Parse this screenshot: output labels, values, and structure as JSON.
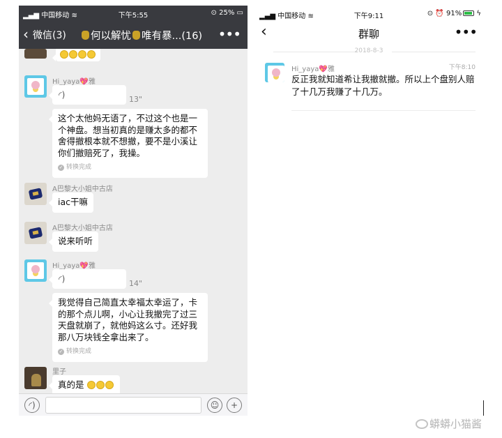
{
  "left_phone": {
    "status": {
      "carrier": "中国移动",
      "time": "下午5:55",
      "battery": "25%"
    },
    "nav": {
      "back_label": "微信(3)",
      "title_part1": "何以解忧",
      "title_part2": "唯有暴...(16)"
    },
    "messages": [
      {
        "sender": "Hi_yaya💖雅",
        "voice_duration": "13\""
      },
      {
        "text": "这个太他妈无语了，不过这个也是一个神盘。想当初真的是赚太多的都不舍得撤根本就不想撤，要不是小溪让你们撤赔死了，我操。",
        "status": "转换完成"
      },
      {
        "sender": "A巴黎大小姐中古店",
        "text": "iac干嘛"
      },
      {
        "sender": "A巴黎大小姐中古店",
        "text": "说来听听"
      },
      {
        "sender": "Hi_yaya💖雅",
        "voice_duration": "14\""
      },
      {
        "text": "我觉得自己简直太幸福太幸运了，卡的那个点儿啊，小心让我撤完了过三天盘就崩了，就他妈这么寸。还好我那八万块钱全拿出来了。",
        "status": "转换完成"
      },
      {
        "sender": "里子",
        "text": "真的是"
      }
    ]
  },
  "right_phone": {
    "status": {
      "carrier": "中国移动",
      "time": "下午9:11",
      "battery": "91%"
    },
    "nav": {
      "title": "群聊"
    },
    "date": "2018-8-3",
    "message": {
      "sender": "Hi_yaya💖雅",
      "time": "下午8:10",
      "text": "反正我就知道希让我撤就撤。所以上个盘别人赔了十几万我赚了十几万。"
    }
  },
  "watermark": "蟒蟒小猫酱",
  "icons": [
    "signal-icon",
    "wifi-icon",
    "battery-icon",
    "back-chevron-icon",
    "money-bag-icon",
    "more-icon",
    "voice-wave-icon",
    "check-icon",
    "emoji-icon",
    "voice-input-icon",
    "plus-icon",
    "alarm-icon",
    "lock-rotation-icon",
    "weibo-icon"
  ]
}
